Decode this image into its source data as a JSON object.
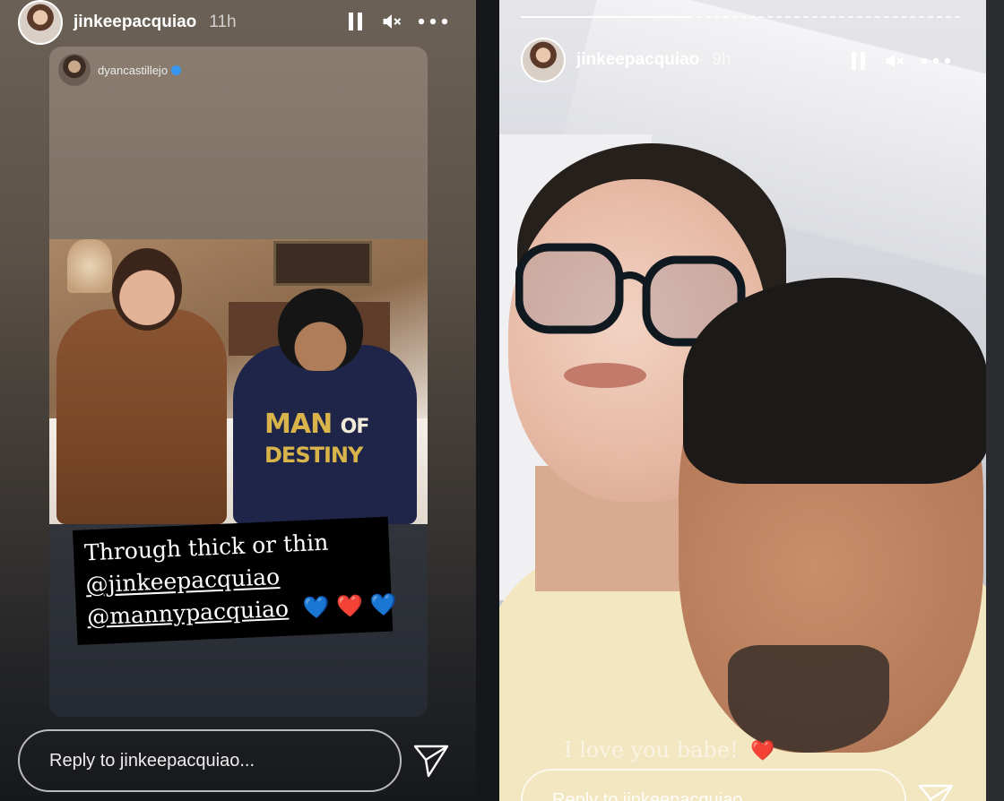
{
  "left_story": {
    "header": {
      "username": "jinkeepacquiao",
      "time": "11h",
      "avatar_icon": "profile-avatar",
      "controls": [
        "pause-icon",
        "mute-icon",
        "more-icon"
      ]
    },
    "repost": {
      "username": "dyancastillejo",
      "verified": true,
      "photo_shirt_text": [
        "MAN",
        "OF",
        "DESTINY"
      ],
      "caption": {
        "line1": "Through thick or thin",
        "mention1": "@jinkeepacquiao",
        "mention2": "@mannypacquiao",
        "hearts": [
          "💙",
          "❤️",
          "💙"
        ]
      }
    },
    "reply": {
      "placeholder": "Reply to jinkeepacquiao...",
      "send_icon": "send-icon"
    }
  },
  "right_story": {
    "header": {
      "username": "jinkeepacquiao",
      "time": "9h",
      "avatar_icon": "profile-avatar",
      "controls": [
        "pause-icon",
        "mute-icon",
        "more-icon"
      ]
    },
    "progress": 0.38,
    "caption": {
      "text": "I love you babe!",
      "heart": "❤️"
    },
    "reply": {
      "placeholder": "Reply to jinkeepacquiao",
      "send_icon": "send-icon"
    }
  },
  "colors": {
    "background": "#16181b",
    "text": "#ffffff",
    "heart_blue": "#2f7cf0",
    "heart_red": "#e3202b",
    "verified_blue": "#3897f0"
  }
}
